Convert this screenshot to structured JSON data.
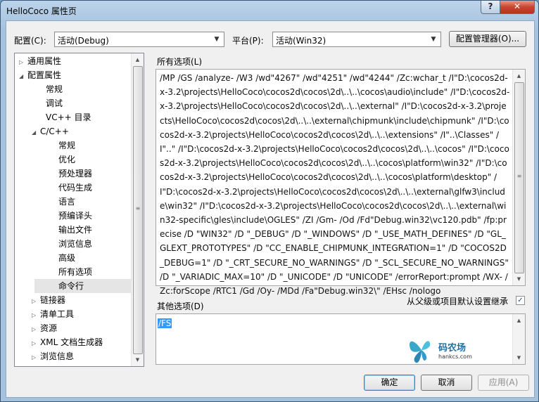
{
  "window": {
    "title": "HelloCoco 属性页",
    "help_label": "?",
    "close_label": "✕"
  },
  "toolbar": {
    "config_label": "配置(C):",
    "config_value": "活动(Debug)",
    "platform_label": "平台(P):",
    "platform_value": "活动(Win32)",
    "config_manager_label": "配置管理器(O)..."
  },
  "tree": {
    "items": [
      {
        "label": "通用属性",
        "tri": "▷"
      },
      {
        "label": "配置属性",
        "tri": "◢"
      },
      {
        "label": "常规",
        "tri": ""
      },
      {
        "label": "调试",
        "tri": ""
      },
      {
        "label": "VC++ 目录",
        "tri": ""
      },
      {
        "label": "C/C++",
        "tri": "◢"
      },
      {
        "label": "常规",
        "tri": ""
      },
      {
        "label": "优化",
        "tri": ""
      },
      {
        "label": "预处理器",
        "tri": ""
      },
      {
        "label": "代码生成",
        "tri": ""
      },
      {
        "label": "语言",
        "tri": ""
      },
      {
        "label": "预编译头",
        "tri": ""
      },
      {
        "label": "输出文件",
        "tri": ""
      },
      {
        "label": "浏览信息",
        "tri": ""
      },
      {
        "label": "高级",
        "tri": ""
      },
      {
        "label": "所有选项",
        "tri": ""
      },
      {
        "label": "命令行",
        "tri": ""
      },
      {
        "label": "链接器",
        "tri": "▷"
      },
      {
        "label": "清单工具",
        "tri": "▷"
      },
      {
        "label": "资源",
        "tri": "▷"
      },
      {
        "label": "XML 文档生成器",
        "tri": "▷"
      },
      {
        "label": "浏览信息",
        "tri": "▷"
      }
    ]
  },
  "all_options": {
    "label": "所有选项(L)",
    "text": "/MP /GS /analyze- /W3 /wd\"4267\" /wd\"4251\" /wd\"4244\" /Zc:wchar_t /I\"D:\\cocos2d-x-3.2\\projects\\HelloCoco\\cocos2d\\cocos\\2d\\..\\..\\cocos\\audio\\include\" /I\"D:\\cocos2d-x-3.2\\projects\\HelloCoco\\cocos2d\\cocos\\2d\\..\\..\\external\" /I\"D:\\cocos2d-x-3.2\\projects\\HelloCoco\\cocos2d\\cocos\\2d\\..\\..\\external\\chipmunk\\include\\chipmunk\" /I\"D:\\cocos2d-x-3.2\\projects\\HelloCoco\\cocos2d\\cocos\\2d\\..\\..\\extensions\" /I\"..\\Classes\" /I\"..\" /I\"D:\\cocos2d-x-3.2\\projects\\HelloCoco\\cocos2d\\cocos\\2d\\..\\..\\cocos\" /I\"D:\\cocos2d-x-3.2\\projects\\HelloCoco\\cocos2d\\cocos\\2d\\..\\..\\cocos\\platform\\win32\" /I\"D:\\cocos2d-x-3.2\\projects\\HelloCoco\\cocos2d\\cocos\\2d\\..\\..\\cocos\\platform\\desktop\" /I\"D:\\cocos2d-x-3.2\\projects\\HelloCoco\\cocos2d\\cocos\\2d\\..\\..\\external\\glfw3\\include\\win32\" /I\"D:\\cocos2d-x-3.2\\projects\\HelloCoco\\cocos2d\\cocos\\2d\\..\\..\\external\\win32-specific\\gles\\include\\OGLES\" /ZI /Gm- /Od /Fd\"Debug.win32\\vc120.pdb\" /fp:precise /D \"WIN32\" /D \"_DEBUG\" /D \"_WINDOWS\" /D \"_USE_MATH_DEFINES\" /D \"GL_GLEXT_PROTOTYPES\" /D \"CC_ENABLE_CHIPMUNK_INTEGRATION=1\" /D \"COCOS2D_DEBUG=1\" /D \"_CRT_SECURE_NO_WARNINGS\" /D \"_SCL_SECURE_NO_WARNINGS\" /D \"_VARIADIC_MAX=10\" /D \"_UNICODE\" /D \"UNICODE\" /errorReport:prompt /WX- /Zc:forScope /RTC1 /Gd /Oy- /MDd /Fa\"Debug.win32\\\" /EHsc /nologo"
  },
  "inherit": {
    "label": "从父级或项目默认设置继承",
    "checked_mark": "✓"
  },
  "other_options": {
    "label": "其他选项(D)",
    "value": "/FS"
  },
  "watermark": {
    "name": "码农场",
    "site": "hankcs.com"
  },
  "buttons": {
    "ok": "确定",
    "cancel": "取消",
    "apply": "应用(A)"
  }
}
